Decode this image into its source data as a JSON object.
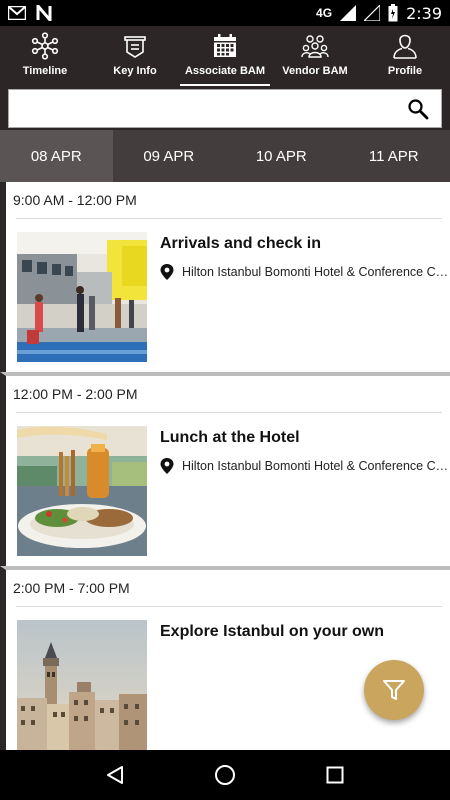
{
  "status_bar": {
    "network": "4G",
    "time": "2:39",
    "icons": [
      "gmail-icon",
      "n-app-icon",
      "signal-icon",
      "battery-icon"
    ]
  },
  "tabs": [
    {
      "label": "Timeline",
      "icon": "network-icon",
      "active": false
    },
    {
      "label": "Key Info",
      "icon": "info-board-icon",
      "active": false
    },
    {
      "label": "Associate BAM",
      "icon": "calendar-icon",
      "active": true
    },
    {
      "label": "Vendor BAM",
      "icon": "group-icon",
      "active": false
    },
    {
      "label": "Profile",
      "icon": "person-icon",
      "active": false
    }
  ],
  "search": {
    "value": "",
    "placeholder": ""
  },
  "dates": [
    {
      "label": "08 APR",
      "active": true
    },
    {
      "label": "09 APR",
      "active": false
    },
    {
      "label": "10 APR",
      "active": false
    },
    {
      "label": "11 APR",
      "active": false
    }
  ],
  "sessions": [
    {
      "time": "9:00 AM - 12:00 PM",
      "title": "Arrivals and check in",
      "location": "Hilton Istanbul Bomonti Hotel & Conference Center",
      "image": "airport-checkin-photo"
    },
    {
      "time": "12:00 PM - 2:00 PM",
      "title": "Lunch at the Hotel",
      "location": "Hilton Istanbul Bomonti Hotel & Conference Center",
      "image": "lunch-plate-photo"
    },
    {
      "time": "2:00 PM - 7:00 PM",
      "title": "Explore Istanbul on your own",
      "location": "",
      "image": "istanbul-galata-photo"
    }
  ],
  "colors": {
    "header": "#2d2627",
    "date_strip": "#443d3e",
    "date_active": "#5b5455",
    "fab": "#c9a55e"
  }
}
